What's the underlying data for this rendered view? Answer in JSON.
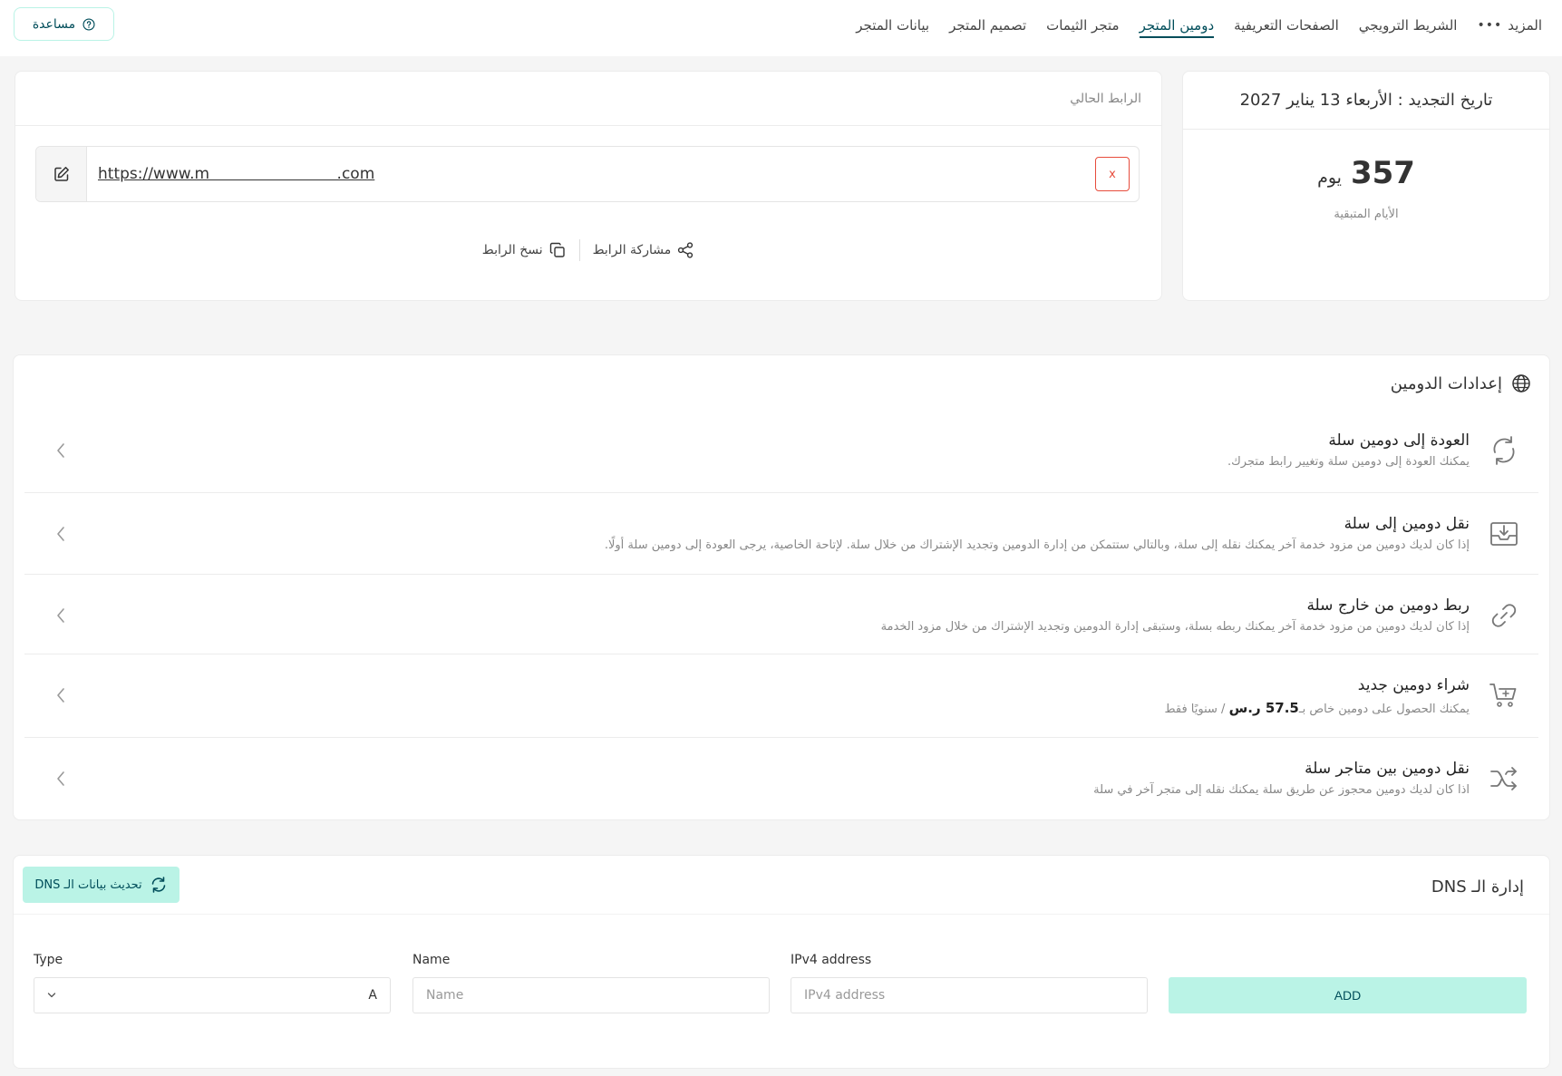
{
  "nav": {
    "items": [
      {
        "label": "بيانات المتجر",
        "active": false
      },
      {
        "label": "تصميم المتجر",
        "active": false
      },
      {
        "label": "متجر الثيمات",
        "active": false
      },
      {
        "label": "دومين المتجر",
        "active": true
      },
      {
        "label": "الصفحات التعريفية",
        "active": false
      },
      {
        "label": "الشريط الترويجي",
        "active": false
      },
      {
        "label": "المزيد",
        "active": false
      }
    ],
    "help_label": "مساعدة"
  },
  "renewal": {
    "title": "تاريخ التجديد : الأربعاء 13 يناير 2027",
    "days": "357",
    "unit": "يوم",
    "subtitle": "الأيام المتبقية"
  },
  "link": {
    "heading": "الرابط الحالي",
    "url": "https://www.m                          .com",
    "clear_label": "x",
    "share_label": "مشاركة الرابط",
    "copy_label": "نسخ الرابط"
  },
  "settings": {
    "title": "إعدادات الدومين",
    "options": [
      {
        "title": "العودة إلى دومين سلة",
        "desc": "يمكنك العودة إلى دومين سلة وتغيير رابط متجرك.",
        "icon": "refresh-arrows-icon"
      },
      {
        "title": "نقل دومين إلى سلة",
        "desc": "إذا كان لديك دومين من مزود خدمة آخر يمكنك نقله إلى سلة، وبالتالي ستتمكن من إدارة الدومين وتجديد الإشتراك من خلال سلة. لإتاحة الخاصية، يرجى العودة إلى دومين سلة أولًا.",
        "icon": "inbox-download-icon"
      },
      {
        "title": "ربط دومين من خارج سلة",
        "desc": "إذا كان لديك دومين من مزود خدمة آخر يمكنك ربطه بسلة، وستبقى إدارة الدومين وتجديد الإشتراك من خلال مزود الخدمة",
        "icon": "link-icon"
      },
      {
        "title": "شراء دومين جديد",
        "desc_prefix": "يمكنك الحصول على دومين خاص بـ",
        "price": "57.5 ر.س",
        "desc_suffix": " / سنويًا فقط",
        "icon": "cart-plus-icon"
      },
      {
        "title": "نقل دومين بين متاجر سلة",
        "desc": "اذا كان لديك دومين محجوز عن طريق سلة يمكنك نقله إلى متجر آخر في سلة",
        "icon": "shuffle-icon"
      }
    ]
  },
  "dns": {
    "title": "إدارة الـ DNS",
    "refresh_label": "تحديث بيانات الـ DNS",
    "type_label": "Type",
    "type_value": "A",
    "name_label": "Name",
    "name_placeholder": "Name",
    "ip_label": "IPv4 address",
    "ip_placeholder": "IPv4 address",
    "add_label": "ADD"
  },
  "colors": {
    "accent": "#004d5a",
    "accent_light": "#baf3e6",
    "danger": "#e74c3c"
  }
}
